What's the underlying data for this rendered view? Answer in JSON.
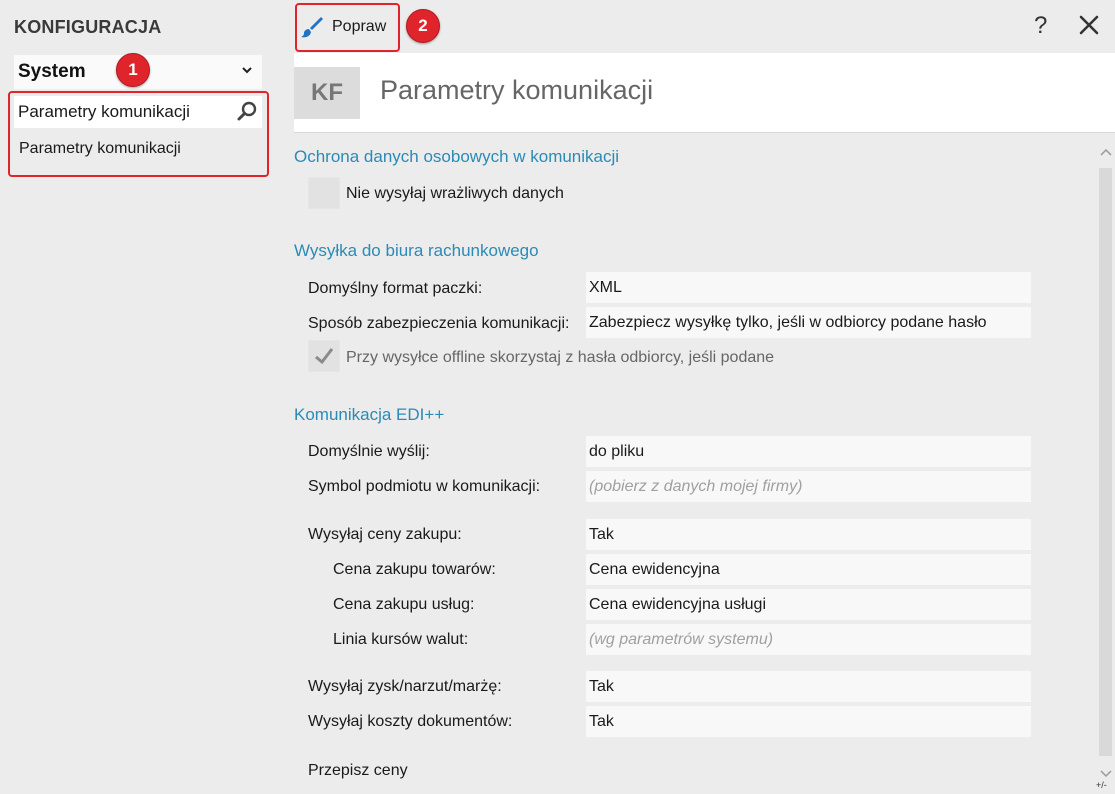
{
  "sidebar": {
    "title": "KONFIGURACJA",
    "module_select": "System",
    "search_value": "Parametry komunikacji",
    "result_item": "Parametry komunikacji",
    "badge": "1"
  },
  "toolbar": {
    "edit_label": "Popraw",
    "badge": "2",
    "help_label": "?"
  },
  "header": {
    "icon_text": "KF",
    "title": "Parametry komunikacji"
  },
  "sections": {
    "privacy": {
      "title": "Ochrona danych osobowych w komunikacji",
      "dont_send_sensitive": "Nie wysyłaj wrażliwych danych"
    },
    "accounting": {
      "title": "Wysyłka do biura rachunkowego",
      "format_label": "Domyślny format paczki:",
      "format_value": "XML",
      "security_label": "Sposób zabezpieczenia komunikacji:",
      "security_value": "Zabezpiecz wysyłkę tylko, jeśli w odbiorcy podane hasło",
      "offline_password": "Przy wysyłce offline skorzystaj z hasła odbiorcy, jeśli podane"
    },
    "edi": {
      "title": "Komunikacja EDI++",
      "send_default_label": "Domyślnie wyślij:",
      "send_default_value": "do pliku",
      "symbol_label": "Symbol podmiotu w komunikacji:",
      "symbol_placeholder": "(pobierz z danych mojej firmy)",
      "purchase_prices_label": "Wysyłaj ceny zakupu:",
      "purchase_prices_value": "Tak",
      "goods_price_label": "Cena zakupu towarów:",
      "goods_price_value": "Cena ewidencyjna",
      "services_price_label": "Cena zakupu usług:",
      "services_price_value": "Cena ewidencyjna usługi",
      "fx_line_label": "Linia kursów walut:",
      "fx_line_placeholder": "(wg parametrów systemu)",
      "profit_label": "Wysyłaj zysk/narzut/marżę:",
      "profit_value": "Tak",
      "costs_label": "Wysyłaj koszty dokumentów:",
      "costs_value": "Tak",
      "rewrite_prices_label": "Przepisz ceny"
    }
  },
  "scroll_corner": "+/-",
  "colors": {
    "accent_red": "#e0242b",
    "section_blue": "#2a8bb7",
    "brush_blue": "#1f72c4"
  }
}
